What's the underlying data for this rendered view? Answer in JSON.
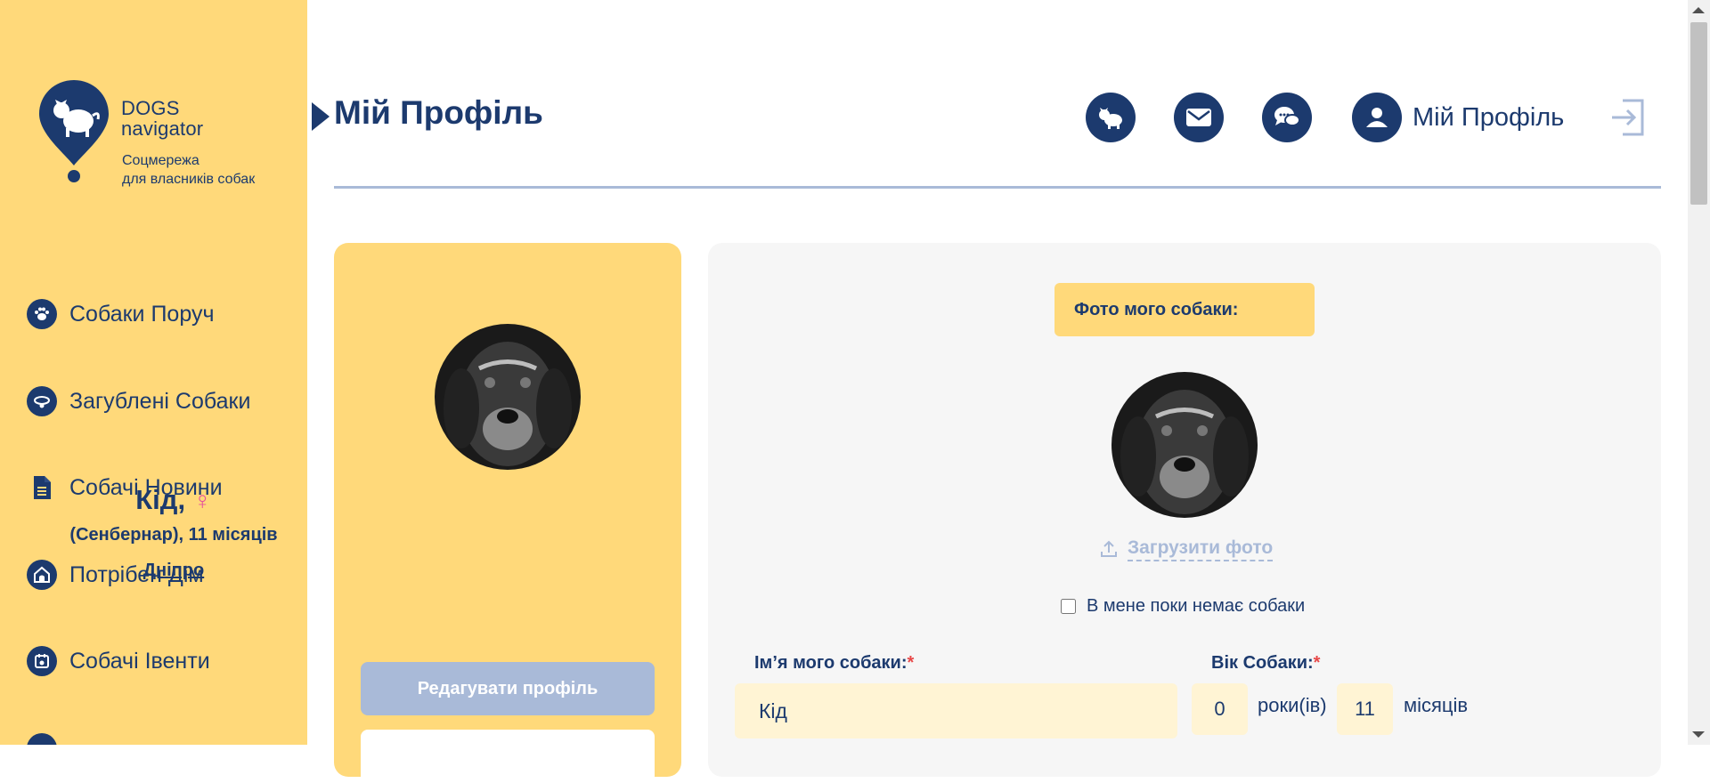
{
  "brand": {
    "title_line1": "DOGS",
    "title_line2": "navigator",
    "tagline_line1": "Соцмережа",
    "tagline_line2": "для власників собак"
  },
  "sidebar": {
    "items": [
      {
        "label": "Собаки Поруч",
        "icon": "paw-icon"
      },
      {
        "label": "Загублені Собаки",
        "icon": "collar-icon"
      },
      {
        "label": "Собачі Новини",
        "icon": "document-icon"
      },
      {
        "label": "Потрібен Дім",
        "icon": "dog-house-icon"
      },
      {
        "label": "Собачі Івенти",
        "icon": "calendar-icon"
      }
    ]
  },
  "header": {
    "page_title": "Мій Профіль",
    "profile_label": "Мій Профіль",
    "icons": [
      "dog-icon",
      "mail-icon",
      "chat-icon",
      "user-icon",
      "logout-icon"
    ]
  },
  "profile_card": {
    "name": "Кід,",
    "gender_symbol": "♀",
    "details": "(Сенбернар), 11 місяців",
    "city": "Дніпро",
    "edit_button": "Редагувати профіль"
  },
  "form": {
    "photo_label": "Фото мого собаки:",
    "upload_label": "Загрузити фото",
    "no_dog_label": "В мене поки немає собаки",
    "name_label": "Ім’я мого собаки:",
    "required_mark": "*",
    "name_value": "Кід",
    "age_label": "Вік Собаки:",
    "age_years_value": "0",
    "age_years_unit": "роки(ів)",
    "age_months_value": "11",
    "age_months_unit": "місяців"
  },
  "colors": {
    "navy": "#1c3a6e",
    "yellow": "#ffd97a",
    "light_blue": "#a9bad8",
    "input_bg": "#fff4d4",
    "panel_bg": "#f6f6f6"
  }
}
